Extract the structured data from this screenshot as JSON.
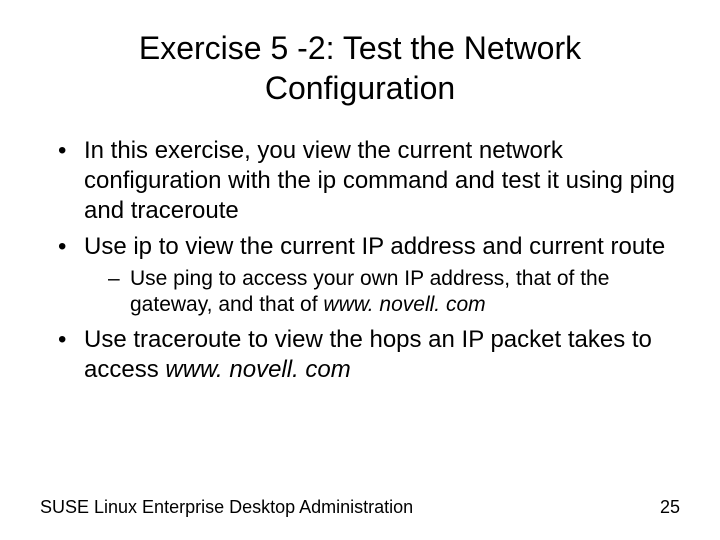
{
  "title": "Exercise 5 -2: Test the Network Configuration",
  "bullets": {
    "b1": "In this exercise, you view the current network configuration with the ip command and test it using ping and traceroute",
    "b2": "Use ip to view the current IP address and current route",
    "b2_sub1_a": "Use ping to access your own IP address, that of the gateway, and that of ",
    "b2_sub1_i": "www. novell. com",
    "b3_a": "Use traceroute to view the hops an IP packet takes to access ",
    "b3_i": "www. novell. com"
  },
  "footer": {
    "left": "SUSE Linux Enterprise Desktop Administration",
    "right": "25"
  }
}
